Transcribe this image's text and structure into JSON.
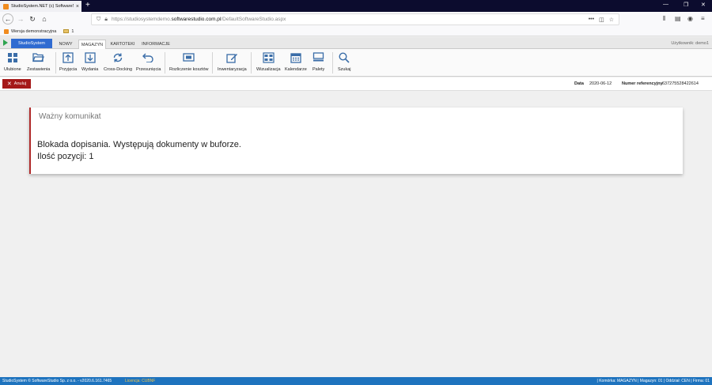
{
  "browser": {
    "tab_title": "StudioSystem.NET (c) SoftwareS",
    "url_prefix": "https://studiosystemdemo.",
    "url_domain": "softwarestudio.com.pl",
    "url_path": "/DefaultSoftwareStudio.aspx",
    "bookmark_label": "Wersja demonstracyjna",
    "bookmark_folder": "1"
  },
  "ribbon_tabs": {
    "app_button": "StudioSystem",
    "tabs": [
      "NOWY",
      "MAGAZYN",
      "KARTOTEKI",
      "INFORMACJE"
    ],
    "user": "Użytkownik: demo1"
  },
  "toolbar": {
    "items": [
      "Ulubione",
      "Zestawienia",
      "Przyjęcia",
      "Wydania",
      "Cross-Docking",
      "Przesunięcia",
      "Rozliczenie kosztów",
      "Inwentaryzacja",
      "Wizualizacja",
      "Kalendarze",
      "Palety",
      "Szukaj"
    ]
  },
  "info": {
    "cancel_label": "Anuluj",
    "date_label": "Data",
    "date_value": "2020-06-12",
    "ref_label": "Numer referencyjny",
    "ref_value": "637275528422614"
  },
  "message": {
    "title": "Ważny komunikat",
    "line1": "Blokada dopisania. Występują dokumenty w buforze.",
    "line2": "Ilość pozycji: 1"
  },
  "status": {
    "left": "StudioSystem © SoftwareStudio Sp. z o.o. - v2020.6.161.7465",
    "license": "Licencja: CUBNF",
    "right": "| Komórka: MAGAZYN | Magazyn: 01 | Oddział: CEN | Firma: 01"
  }
}
